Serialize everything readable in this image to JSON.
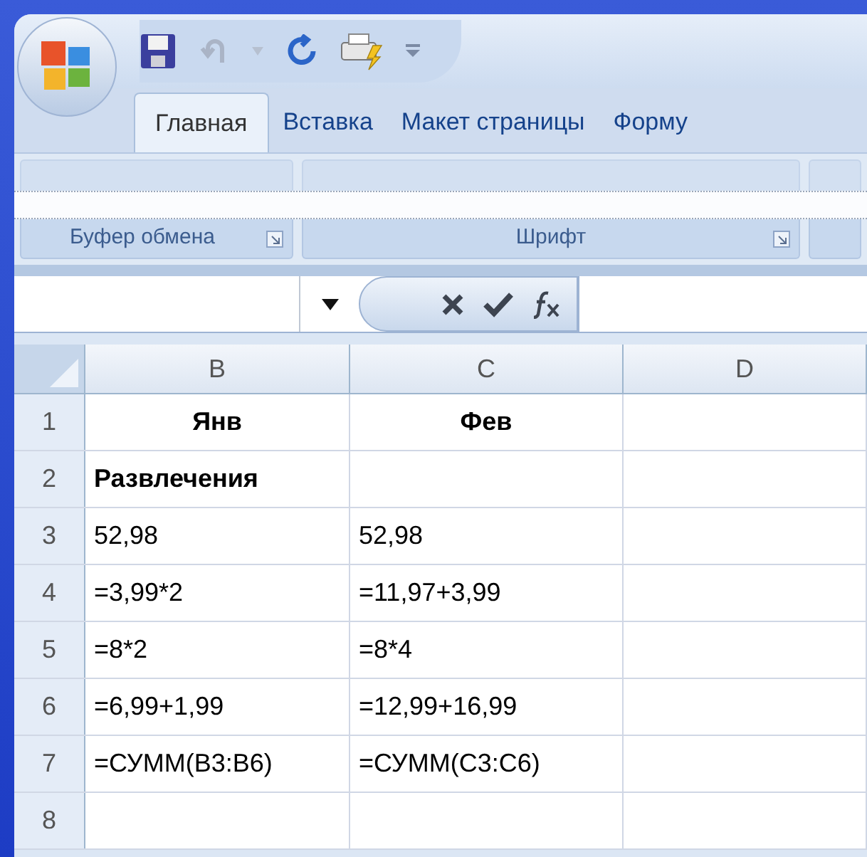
{
  "tabs": [
    {
      "label": "Главная",
      "selected": true
    },
    {
      "label": "Вставка",
      "selected": false
    },
    {
      "label": "Макет страницы",
      "selected": false
    },
    {
      "label": "Форму",
      "selected": false
    }
  ],
  "ribbon_groups": [
    {
      "label": "Буфер обмена",
      "launcher": true
    },
    {
      "label": "Шрифт",
      "launcher": true
    }
  ],
  "columns": [
    "B",
    "C",
    "D"
  ],
  "rows": [
    {
      "number": "1",
      "kind": "heading",
      "cells": [
        "Янв",
        "Фев",
        ""
      ]
    },
    {
      "number": "2",
      "kind": "bold",
      "cells": [
        "Развлечения",
        "",
        ""
      ]
    },
    {
      "number": "3",
      "kind": "plain",
      "cells": [
        "52,98",
        "52,98",
        ""
      ]
    },
    {
      "number": "4",
      "kind": "plain",
      "cells": [
        "=3,99*2",
        "=11,97+3,99",
        ""
      ]
    },
    {
      "number": "5",
      "kind": "plain",
      "cells": [
        "=8*2",
        "=8*4",
        ""
      ]
    },
    {
      "number": "6",
      "kind": "plain",
      "cells": [
        "=6,99+1,99",
        "=12,99+16,99",
        ""
      ]
    },
    {
      "number": "7",
      "kind": "plain",
      "cells": [
        "=СУММ(B3:B6)",
        "=СУММ(C3:C6)",
        ""
      ]
    },
    {
      "number": "8",
      "kind": "plain",
      "cells": [
        "",
        "",
        ""
      ]
    }
  ]
}
